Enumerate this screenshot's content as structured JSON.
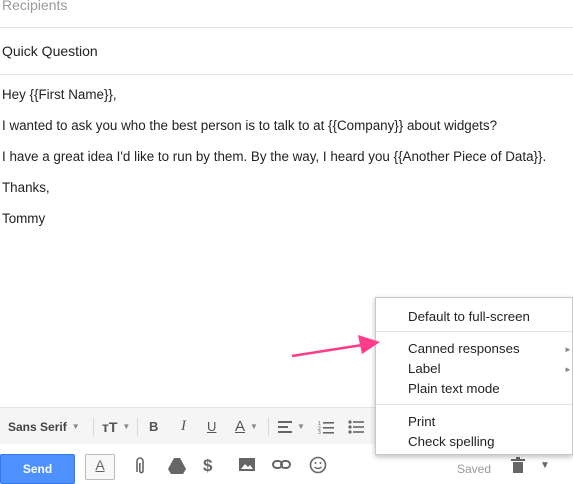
{
  "compose": {
    "recipients_placeholder": "Recipients",
    "subject": "Quick Question",
    "body_lines": [
      "Hey {{First Name}},",
      "I wanted to ask you who the best person is to talk to at {{Company}} about widgets?",
      "I have a great idea I'd like to run by them. By the way, I heard you {{Another Piece of Data}}.",
      "Thanks,",
      "Tommy"
    ]
  },
  "toolbar": {
    "font_family": "Sans Serif",
    "font_size_icon": "text-size-icon",
    "bold": "B",
    "italic": "I",
    "underline": "U",
    "text_color": "A",
    "align_icon": "align-icon",
    "numbered_list_icon": "numbered-list-icon",
    "bulleted_list_icon": "bulleted-list-icon"
  },
  "bottom": {
    "send_label": "Send",
    "formatting_label": "A",
    "saved_label": "Saved",
    "icons": [
      "attach-icon",
      "drive-icon",
      "money-icon",
      "photo-icon",
      "link-icon",
      "emoji-icon",
      "trash-icon"
    ]
  },
  "menu": {
    "items": [
      {
        "label": "Default to full-screen",
        "submenu": false
      },
      {
        "label": "Canned responses",
        "submenu": true
      },
      {
        "label": "Label",
        "submenu": true
      },
      {
        "label": "Plain text mode",
        "submenu": false
      },
      {
        "label": "Print",
        "submenu": false
      },
      {
        "label": "Check spelling",
        "submenu": false
      }
    ]
  },
  "colors": {
    "send_button": "#4d90fe",
    "annotation_arrow": "#ff3b8a"
  }
}
